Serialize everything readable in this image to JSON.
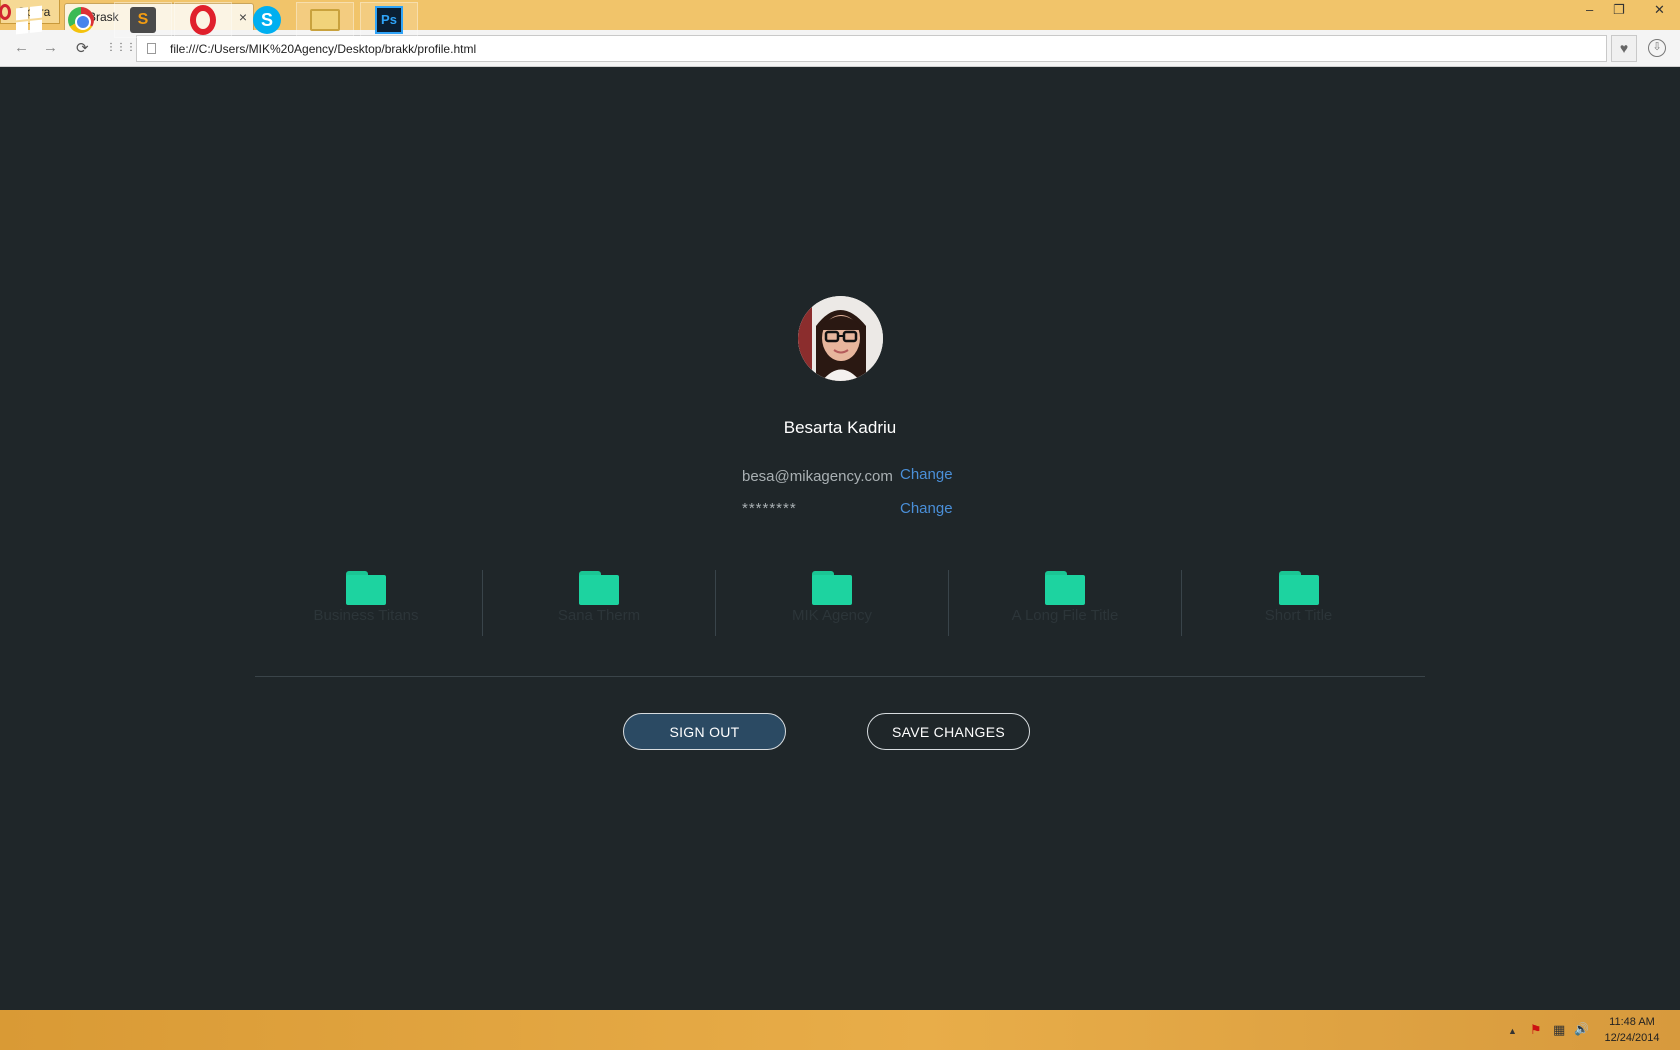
{
  "browser": {
    "menu_label": "Opera",
    "tab_title": "Brask",
    "tab_close_glyph": "×",
    "new_tab_glyph": "+",
    "url": "file:///C:/Users/MIK%20Agency/Desktop/brakk/profile.html",
    "window_controls": {
      "minimize": "–",
      "restore": "❐",
      "close": "✕"
    },
    "nav_glyphs": {
      "back": "←",
      "forward": "→",
      "reload": "⟳",
      "speed_dial": "⋮⋮⋮",
      "heart": "♥",
      "download": "⇩"
    }
  },
  "profile": {
    "name": "Besarta Kadriu",
    "email": "besa@mikagency.com",
    "password_mask": "********",
    "change_email_label": "Change",
    "change_password_label": "Change"
  },
  "folders": [
    {
      "label": "Business Titans",
      "icon": "folder-icon"
    },
    {
      "label": "Sana Therm",
      "icon": "folder-icon"
    },
    {
      "label": "MIK Agency",
      "icon": "folder-icon"
    },
    {
      "label": "A Long File Title",
      "icon": "folder-icon"
    },
    {
      "label": "Short Title",
      "icon": "folder-icon"
    }
  ],
  "actions": {
    "sign_out_label": "SIGN OUT",
    "save_changes_label": "SAVE CHANGES"
  },
  "taskbar": {
    "apps": [
      "windows-start",
      "chrome",
      "sublime-text",
      "opera",
      "skype",
      "file-explorer",
      "photoshop"
    ],
    "sublime_glyph": "S",
    "skype_glyph": "S",
    "ps_glyph": "Ps",
    "tray_glyphs": {
      "show_hidden": "▲",
      "flag": "⚑",
      "network": "▦",
      "volume": "🔊"
    },
    "time": "11:48 AM",
    "date": "12/24/2014"
  },
  "colors": {
    "page_background": "#1f2629",
    "accent_folder": "#1dd3a0",
    "link": "#4a8fd8",
    "sign_out_button": "#2b4a63",
    "titlebar": "#f1c46a"
  }
}
